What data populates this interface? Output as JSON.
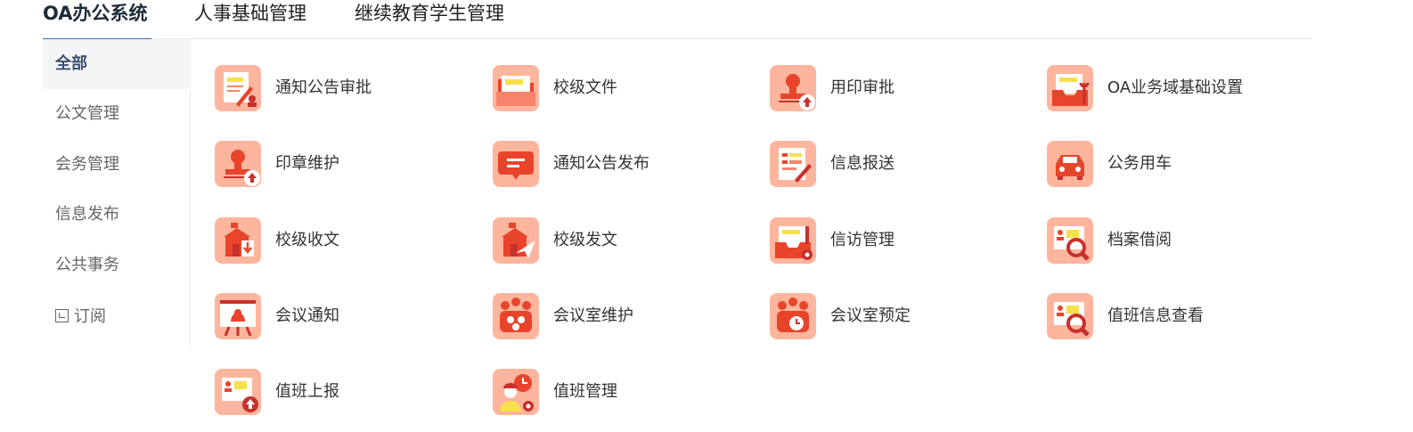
{
  "top_tabs": [
    {
      "label": "OA办公系统",
      "active": true
    },
    {
      "label": "人事基础管理",
      "active": false
    },
    {
      "label": "继续教育学生管理",
      "active": false
    }
  ],
  "sidebar": {
    "items": [
      {
        "label": "全部",
        "active": true
      },
      {
        "label": "公文管理"
      },
      {
        "label": "会务管理"
      },
      {
        "label": "信息发布"
      },
      {
        "label": "公共事务"
      },
      {
        "label": "订阅"
      }
    ]
  },
  "apps": [
    {
      "label": "通知公告审批",
      "icon": "document-approve-icon"
    },
    {
      "label": "校级文件",
      "icon": "folder-icon"
    },
    {
      "label": "用印审批",
      "icon": "stamp-approve-icon"
    },
    {
      "label": "OA业务域基础设置",
      "icon": "tray-settings-icon"
    },
    {
      "label": "印章维护",
      "icon": "stamp-maintain-icon"
    },
    {
      "label": "通知公告发布",
      "icon": "message-publish-icon"
    },
    {
      "label": "信息报送",
      "icon": "info-report-icon"
    },
    {
      "label": "公务用车",
      "icon": "car-icon"
    },
    {
      "label": "校级收文",
      "icon": "incoming-doc-icon"
    },
    {
      "label": "校级发文",
      "icon": "outgoing-doc-icon"
    },
    {
      "label": "信访管理",
      "icon": "petition-icon"
    },
    {
      "label": "档案借阅",
      "icon": "archive-search-icon"
    },
    {
      "label": "会议通知",
      "icon": "meeting-bell-icon"
    },
    {
      "label": "会议室维护",
      "icon": "meeting-room-maintain-icon"
    },
    {
      "label": "会议室预定",
      "icon": "meeting-room-book-icon"
    },
    {
      "label": "值班信息查看",
      "icon": "duty-search-icon"
    },
    {
      "label": "值班上报",
      "icon": "duty-upload-icon"
    },
    {
      "label": "值班管理",
      "icon": "duty-manage-icon"
    }
  ],
  "colors": {
    "icon_bg": "#fdb59d",
    "icon_accent": "#e8442b",
    "icon_yellow": "#f8e04a",
    "active_tab_underline": "#3b6db5",
    "sidebar_active_bg": "#f4f5f7"
  }
}
